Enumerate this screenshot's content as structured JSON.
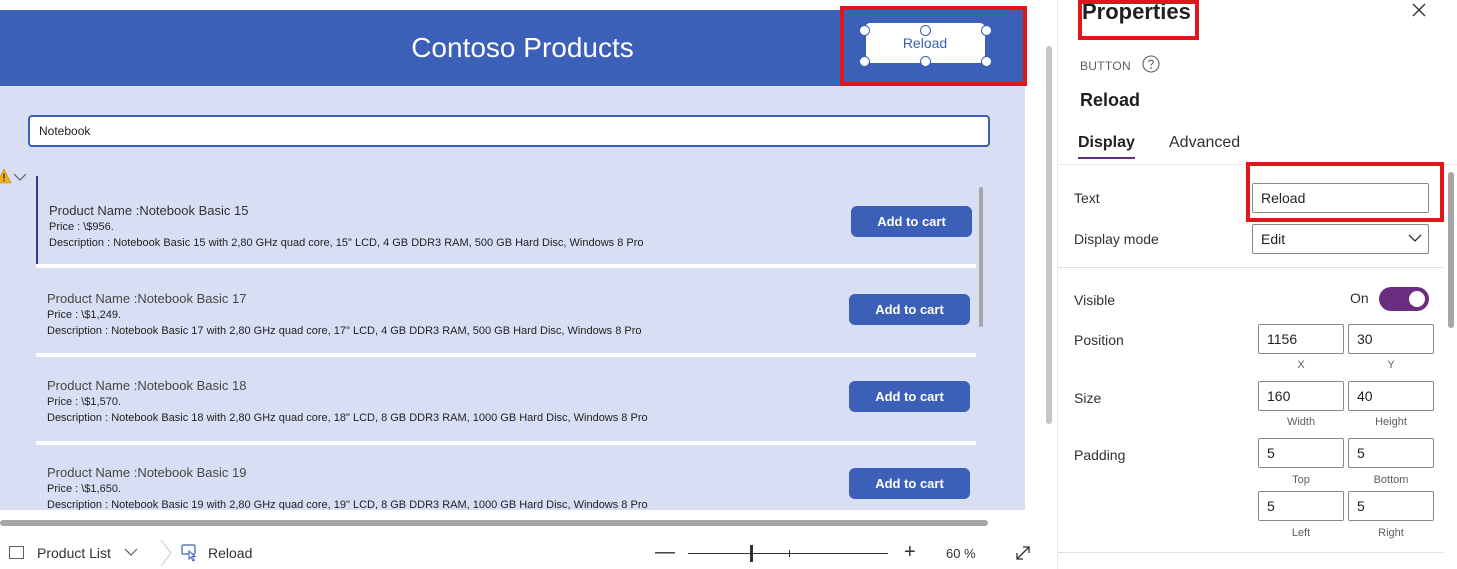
{
  "app": {
    "title": "Contoso Products",
    "reload_label": "Reload",
    "search_value": "Notebook"
  },
  "products": [
    {
      "name": "Product Name :Notebook Basic 15",
      "price": "Price :  \\$956.",
      "description": "Description : Notebook Basic 15 with 2,80 GHz quad core, 15\" LCD, 4 GB DDR3 RAM, 500 GB Hard Disc, Windows 8 Pro",
      "button": "Add to cart"
    },
    {
      "name": "Product Name :Notebook Basic 17",
      "price": "Price :  \\$1,249.",
      "description": "Description : Notebook Basic 17 with 2,80 GHz quad core, 17\" LCD, 4 GB DDR3 RAM, 500 GB Hard Disc, Windows 8 Pro",
      "button": "Add to cart"
    },
    {
      "name": "Product Name :Notebook Basic 18",
      "price": "Price :  \\$1,570.",
      "description": "Description : Notebook Basic 18 with 2,80 GHz quad core, 18\" LCD, 8 GB DDR3 RAM, 1000 GB Hard Disc, Windows 8 Pro",
      "button": "Add to cart"
    },
    {
      "name": "Product Name :Notebook Basic 19",
      "price": "Price :  \\$1,650.",
      "description": "Description : Notebook Basic 19 with 2,80 GHz quad core, 19\" LCD, 8 GB DDR3 RAM, 1000 GB Hard Disc, Windows 8 Pro",
      "button": "Add to cart"
    }
  ],
  "statusbar": {
    "screen": "Product List",
    "control": "Reload",
    "zoom_minus": "—",
    "zoom_plus": "+",
    "zoom": "60  %"
  },
  "properties": {
    "title": "Properties",
    "control_type": "BUTTON",
    "control_name": "Reload",
    "tabs": [
      "Display",
      "Advanced"
    ],
    "text_label": "Text",
    "text_value": "Reload",
    "display_mode_label": "Display mode",
    "display_mode_value": "Edit",
    "visible_label": "Visible",
    "visible_state": "On",
    "position_label": "Position",
    "position_x": "1156",
    "position_y": "30",
    "position_x_label": "X",
    "position_y_label": "Y",
    "size_label": "Size",
    "size_width": "160",
    "size_height": "40",
    "size_width_label": "Width",
    "size_height_label": "Height",
    "padding_label": "Padding",
    "padding_top": "5",
    "padding_bottom": "5",
    "padding_left": "5",
    "padding_right": "5",
    "padding_top_label": "Top",
    "padding_bottom_label": "Bottom",
    "padding_left_label": "Left",
    "padding_right_label": "Right"
  },
  "colors": {
    "header": "#3c5fb7",
    "app_background": "#d8dff5",
    "highlight": "#e0161b",
    "accent": "#6b2d7f"
  },
  "icons": [
    "warning-icon",
    "chevron-down-icon",
    "screen-icon",
    "button-control-icon",
    "fit-screen-icon",
    "close-icon",
    "help-icon"
  ]
}
